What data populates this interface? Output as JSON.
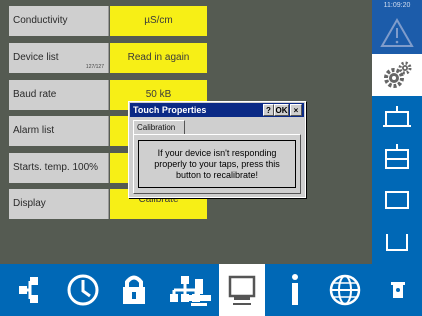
{
  "settings": [
    {
      "label": "Conductivity",
      "sublabel": "",
      "value": "µS/cm"
    },
    {
      "label": "Device list",
      "sublabel": "127/127",
      "value": "Read in again"
    },
    {
      "label": "Baud rate",
      "sublabel": "",
      "value": "50 kB"
    },
    {
      "label": "Alarm list",
      "sublabel": "",
      "value": ""
    },
    {
      "label": "Starts. temp. 100%",
      "sublabel": "",
      "value": ""
    },
    {
      "label": "Display",
      "sublabel": "",
      "value": "Calibrate"
    }
  ],
  "dialog": {
    "title": "Touch Properties",
    "help_label": "?",
    "ok_label": "OK",
    "close_label": "×",
    "tab_label": "Calibration",
    "message": "If your device isn't responding properly to your taps, press this button to recalibrate!"
  },
  "status": {
    "time": "11:09:20"
  },
  "icons": {
    "sidebar": [
      "warning-icon",
      "settings-gears-icon",
      "position-top-icon",
      "position-upper-icon",
      "position-middle-icon",
      "position-bottom-icon"
    ],
    "bottombar": [
      "network-icon",
      "clock-icon",
      "lock-icon",
      "hierarchy-icon",
      "user-icon",
      "display-icon",
      "info-icon",
      "globe-icon",
      "service-icon"
    ]
  },
  "colors": {
    "panel_background": "#555b52",
    "value_yellow": "#f7ef16",
    "label_gray": "#cfcfcf",
    "nav_blue": "#0068b6",
    "dialog_title_blue": "#0b2a86"
  }
}
